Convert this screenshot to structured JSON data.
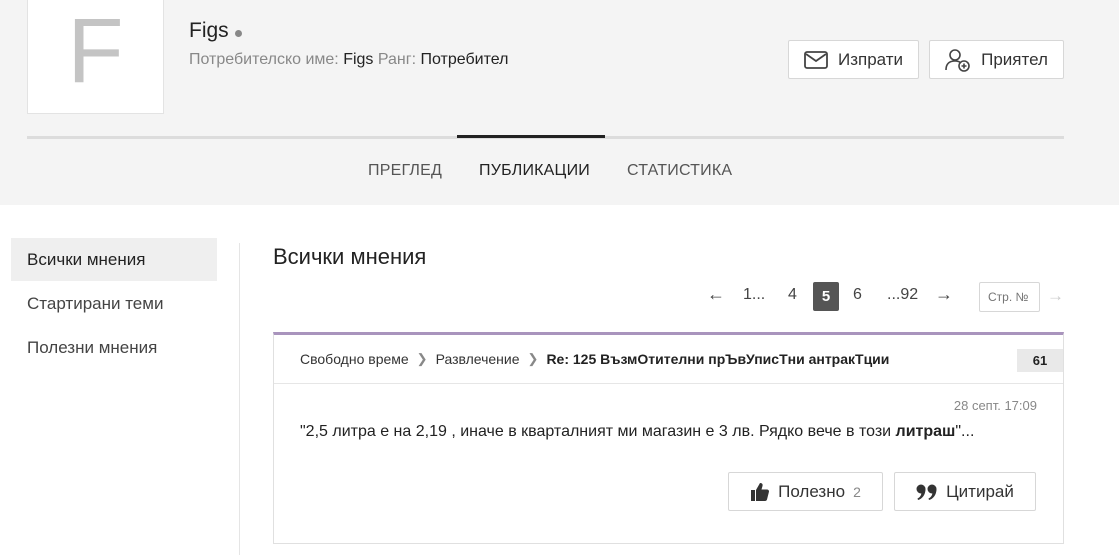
{
  "profile": {
    "avatar_letter": "F",
    "name": "Figs",
    "username_label": "Потребителско име:",
    "username_value": "Figs",
    "rank_label": "Ранг:",
    "rank_value": "Потребител"
  },
  "actions": {
    "send_label": "Изпрати",
    "friend_label": "Приятел"
  },
  "tabs": [
    {
      "label": "ПРЕГЛЕД"
    },
    {
      "label": "ПУБЛИКАЦИИ",
      "active": true
    },
    {
      "label": "СТАТИСТИКА"
    }
  ],
  "sidebar": {
    "items": [
      {
        "label": "Всички мнения",
        "active": true
      },
      {
        "label": "Стартирани теми"
      },
      {
        "label": "Полезни мнения"
      }
    ]
  },
  "main": {
    "title": "Всички мнения"
  },
  "pagination": {
    "prev": "←",
    "first": "1...",
    "p4": "4",
    "current": "5",
    "p6": "6",
    "last": "...92",
    "next": "→",
    "input_placeholder": "Стр. №",
    "next_disabled": "→"
  },
  "post": {
    "crumb1": "Свободно време",
    "crumb2": "Развлечение",
    "crumb3": "Re: 125 ВъзмОтителни прЪвУписТни антракТции",
    "count": "61",
    "date": "28 септ. 17:09",
    "text_before": "\"2,5 литра е на 2,19 , иначе в кварталният ми магазин е 3 лв. Рядко вече в този ",
    "text_bold": "литраш",
    "text_after": "\"...",
    "useful_label": "Полезно",
    "useful_count": "2",
    "quote_label": "Цитирай"
  },
  "icons": {
    "send": "envelope-icon",
    "friend": "add-user-icon",
    "useful": "thumbs-up-icon",
    "quote": "quote-icon"
  },
  "colors": {
    "card_accent": "#a994bd",
    "active_page": "#555555"
  }
}
